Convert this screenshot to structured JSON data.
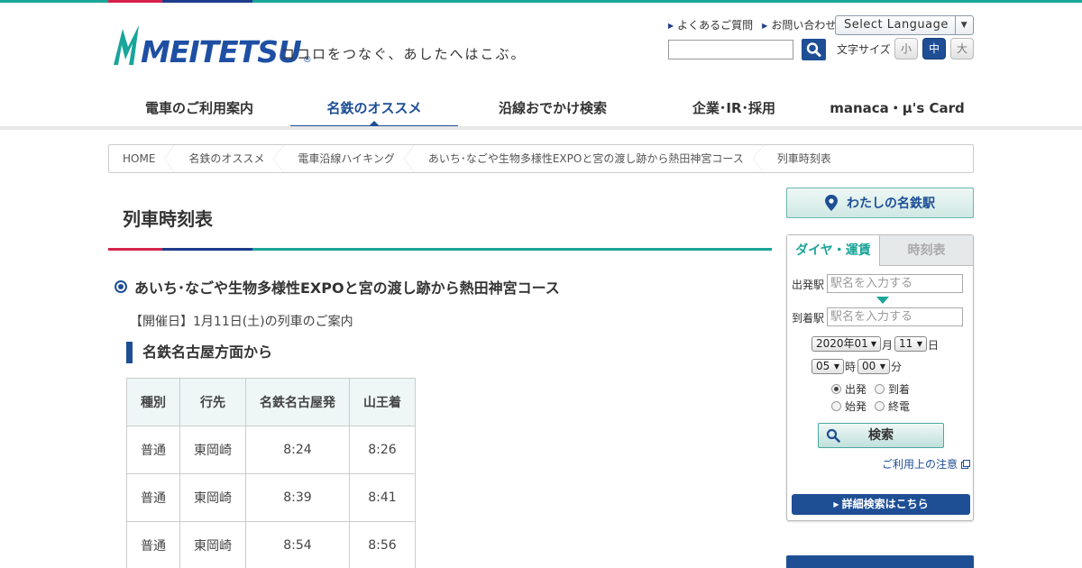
{
  "header": {
    "logo_text": "MEITETSU",
    "logo_mark": "®",
    "tagline": "ココロをつなぐ、あしたへはこぶ。",
    "util_links": [
      "よくあるご質問",
      "お問い合わせ"
    ],
    "language_select": "Select Language",
    "font_size_label": "文字サイズ",
    "font_sizes": [
      "小",
      "中",
      "大"
    ]
  },
  "nav": {
    "items": [
      "電車のご利用案内",
      "名鉄のオススメ",
      "沿線おでかけ検索",
      "企業･IR･採用",
      "manaca・μ's Card"
    ]
  },
  "breadcrumb": [
    "HOME",
    "名鉄のオススメ",
    "電車沿線ハイキング",
    "あいち･なごや生物多様性EXPOと宮の渡し跡から熱田神宮コース",
    "列車時刻表"
  ],
  "main": {
    "title": "列車時刻表",
    "course": "あいち･なごや生物多様性EXPOと宮の渡し跡から熱田神宮コース",
    "date": "【開催日】1月11日(土)の列車のご案内",
    "subhead": "名鉄名古屋方面から",
    "table": {
      "headers": [
        "種別",
        "行先",
        "名鉄名古屋発",
        "山王着"
      ],
      "rows": [
        [
          "普通",
          "東岡崎",
          "8:24",
          "8:26"
        ],
        [
          "普通",
          "東岡崎",
          "8:39",
          "8:41"
        ],
        [
          "普通",
          "東岡崎",
          "8:54",
          "8:56"
        ]
      ]
    }
  },
  "sidebar": {
    "my_meitetsu": "わたしの名鉄駅",
    "tabs": [
      "ダイヤ・運賃",
      "時刻表"
    ],
    "from_label": "出発駅",
    "to_label": "到着駅",
    "station_placeholder": "駅名を入力する",
    "year_month": "2020年01",
    "month_unit": "月",
    "day": "11",
    "day_unit": "日",
    "hour": "05",
    "hour_unit": "時",
    "minute": "00",
    "minute_unit": "分",
    "radios": [
      "出発",
      "到着",
      "始発",
      "終電"
    ],
    "search_label": "検索",
    "notice_link": "ご利用上の注意",
    "detail_search": "詳細検索はこちら"
  },
  "colors": {
    "brand_navy": "#1e4f95",
    "brand_teal": "#1aa59a",
    "brand_red": "#d6234b"
  }
}
